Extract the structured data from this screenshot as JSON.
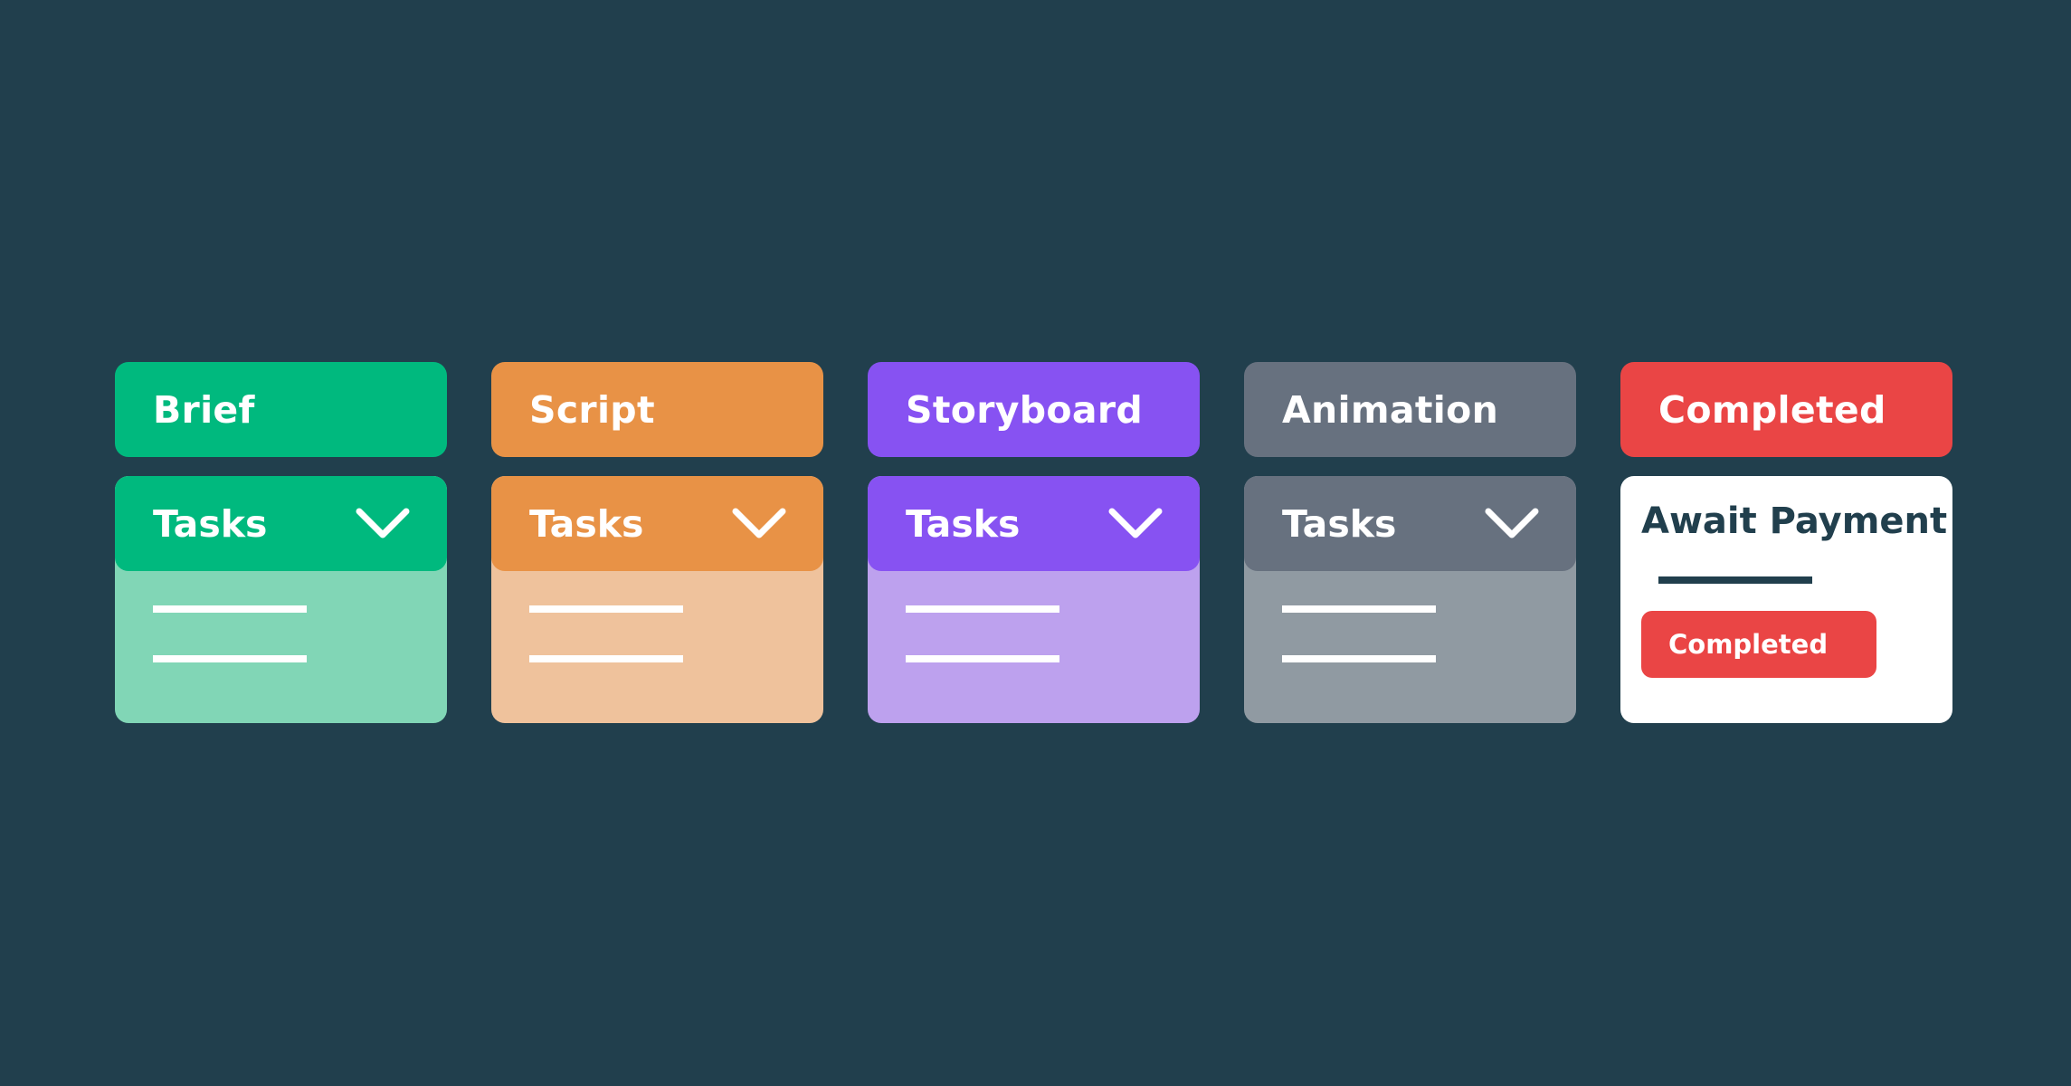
{
  "colors": {
    "background": "#213f4d",
    "text_dark": "#213f4d",
    "white": "#ffffff"
  },
  "columns": [
    {
      "title": "Brief",
      "card_label": "Tasks",
      "accent": "#00b97e",
      "card_body": "#81d6b6",
      "chevron_icon": "chevron-down-icon"
    },
    {
      "title": "Script",
      "card_label": "Tasks",
      "accent": "#e89246",
      "card_body": "#efc29c",
      "chevron_icon": "chevron-down-icon"
    },
    {
      "title": "Storyboard",
      "card_label": "Tasks",
      "accent": "#8752f2",
      "card_body": "#bda1ee",
      "chevron_icon": "chevron-down-icon"
    },
    {
      "title": "Animation",
      "card_label": "Tasks",
      "accent": "#67717f",
      "card_body": "#909aa2",
      "chevron_icon": "chevron-down-icon"
    }
  ],
  "completed_column": {
    "title": "Completed",
    "accent": "#ea4545",
    "card_title": "Await Payment",
    "badge_label": "Completed"
  }
}
